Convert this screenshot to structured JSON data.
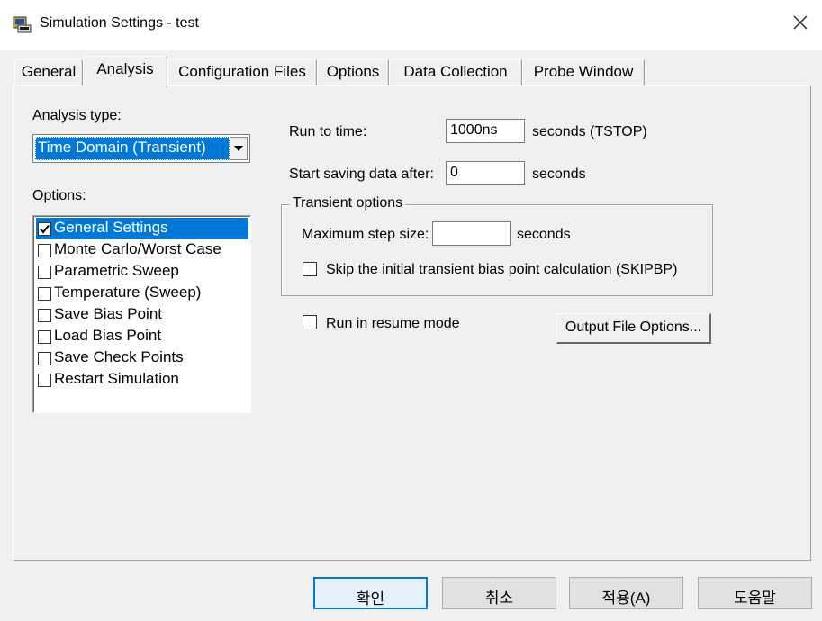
{
  "window": {
    "title": "Simulation Settings - test",
    "app_icon": "simulation-app-icon",
    "close_icon": "close-icon"
  },
  "tabs": [
    {
      "label": "General"
    },
    {
      "label": "Analysis",
      "active": true
    },
    {
      "label": "Configuration Files"
    },
    {
      "label": "Options"
    },
    {
      "label": "Data Collection"
    },
    {
      "label": "Probe Window"
    }
  ],
  "analysis": {
    "analysis_type_label": "Analysis type:",
    "analysis_type_value": "Time Domain (Transient)",
    "options_label": "Options:",
    "options": [
      {
        "label": "General Settings",
        "checked": true,
        "selected": true
      },
      {
        "label": "Monte Carlo/Worst Case",
        "checked": false
      },
      {
        "label": "Parametric Sweep",
        "checked": false
      },
      {
        "label": "Temperature (Sweep)",
        "checked": false
      },
      {
        "label": "Save Bias Point",
        "checked": false
      },
      {
        "label": "Load Bias Point",
        "checked": false
      },
      {
        "label": "Save Check Points",
        "checked": false
      },
      {
        "label": "Restart Simulation",
        "checked": false
      }
    ],
    "run_to_time_label": "Run to time:",
    "run_to_time_value": "1000ns",
    "run_to_time_unit": "seconds  (TSTOP)",
    "start_saving_label": "Start saving data after:",
    "start_saving_value": "0",
    "start_saving_unit": "seconds",
    "transient_group_title": "Transient options",
    "max_step_label": "Maximum step size:",
    "max_step_value": "",
    "max_step_unit": "seconds",
    "skip_bias_label": "Skip the initial transient bias point calculation  (SKIPBP)",
    "skip_bias_checked": false,
    "resume_label": "Run in resume mode",
    "resume_checked": false,
    "output_file_options_label": "Output File Options..."
  },
  "buttons": {
    "ok": "확인",
    "cancel": "취소",
    "apply": "적용(A)",
    "help": "도움말"
  },
  "colors": {
    "selection": "#0078d7",
    "dialog_bg": "#f0f0f0"
  }
}
